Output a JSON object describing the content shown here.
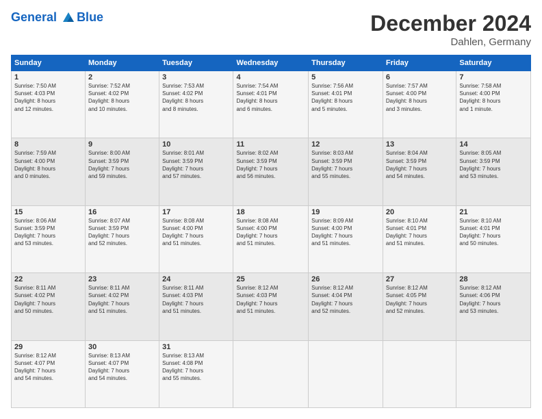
{
  "header": {
    "logo_line1": "General",
    "logo_line2": "Blue",
    "month": "December 2024",
    "location": "Dahlen, Germany"
  },
  "days_of_week": [
    "Sunday",
    "Monday",
    "Tuesday",
    "Wednesday",
    "Thursday",
    "Friday",
    "Saturday"
  ],
  "weeks": [
    [
      {
        "day": "1",
        "lines": [
          "Sunrise: 7:50 AM",
          "Sunset: 4:03 PM",
          "Daylight: 8 hours",
          "and 12 minutes."
        ]
      },
      {
        "day": "2",
        "lines": [
          "Sunrise: 7:52 AM",
          "Sunset: 4:02 PM",
          "Daylight: 8 hours",
          "and 10 minutes."
        ]
      },
      {
        "day": "3",
        "lines": [
          "Sunrise: 7:53 AM",
          "Sunset: 4:02 PM",
          "Daylight: 8 hours",
          "and 8 minutes."
        ]
      },
      {
        "day": "4",
        "lines": [
          "Sunrise: 7:54 AM",
          "Sunset: 4:01 PM",
          "Daylight: 8 hours",
          "and 6 minutes."
        ]
      },
      {
        "day": "5",
        "lines": [
          "Sunrise: 7:56 AM",
          "Sunset: 4:01 PM",
          "Daylight: 8 hours",
          "and 5 minutes."
        ]
      },
      {
        "day": "6",
        "lines": [
          "Sunrise: 7:57 AM",
          "Sunset: 4:00 PM",
          "Daylight: 8 hours",
          "and 3 minutes."
        ]
      },
      {
        "day": "7",
        "lines": [
          "Sunrise: 7:58 AM",
          "Sunset: 4:00 PM",
          "Daylight: 8 hours",
          "and 1 minute."
        ]
      }
    ],
    [
      {
        "day": "8",
        "lines": [
          "Sunrise: 7:59 AM",
          "Sunset: 4:00 PM",
          "Daylight: 8 hours",
          "and 0 minutes."
        ]
      },
      {
        "day": "9",
        "lines": [
          "Sunrise: 8:00 AM",
          "Sunset: 3:59 PM",
          "Daylight: 7 hours",
          "and 59 minutes."
        ]
      },
      {
        "day": "10",
        "lines": [
          "Sunrise: 8:01 AM",
          "Sunset: 3:59 PM",
          "Daylight: 7 hours",
          "and 57 minutes."
        ]
      },
      {
        "day": "11",
        "lines": [
          "Sunrise: 8:02 AM",
          "Sunset: 3:59 PM",
          "Daylight: 7 hours",
          "and 56 minutes."
        ]
      },
      {
        "day": "12",
        "lines": [
          "Sunrise: 8:03 AM",
          "Sunset: 3:59 PM",
          "Daylight: 7 hours",
          "and 55 minutes."
        ]
      },
      {
        "day": "13",
        "lines": [
          "Sunrise: 8:04 AM",
          "Sunset: 3:59 PM",
          "Daylight: 7 hours",
          "and 54 minutes."
        ]
      },
      {
        "day": "14",
        "lines": [
          "Sunrise: 8:05 AM",
          "Sunset: 3:59 PM",
          "Daylight: 7 hours",
          "and 53 minutes."
        ]
      }
    ],
    [
      {
        "day": "15",
        "lines": [
          "Sunrise: 8:06 AM",
          "Sunset: 3:59 PM",
          "Daylight: 7 hours",
          "and 53 minutes."
        ]
      },
      {
        "day": "16",
        "lines": [
          "Sunrise: 8:07 AM",
          "Sunset: 3:59 PM",
          "Daylight: 7 hours",
          "and 52 minutes."
        ]
      },
      {
        "day": "17",
        "lines": [
          "Sunrise: 8:08 AM",
          "Sunset: 4:00 PM",
          "Daylight: 7 hours",
          "and 51 minutes."
        ]
      },
      {
        "day": "18",
        "lines": [
          "Sunrise: 8:08 AM",
          "Sunset: 4:00 PM",
          "Daylight: 7 hours",
          "and 51 minutes."
        ]
      },
      {
        "day": "19",
        "lines": [
          "Sunrise: 8:09 AM",
          "Sunset: 4:00 PM",
          "Daylight: 7 hours",
          "and 51 minutes."
        ]
      },
      {
        "day": "20",
        "lines": [
          "Sunrise: 8:10 AM",
          "Sunset: 4:01 PM",
          "Daylight: 7 hours",
          "and 51 minutes."
        ]
      },
      {
        "day": "21",
        "lines": [
          "Sunrise: 8:10 AM",
          "Sunset: 4:01 PM",
          "Daylight: 7 hours",
          "and 50 minutes."
        ]
      }
    ],
    [
      {
        "day": "22",
        "lines": [
          "Sunrise: 8:11 AM",
          "Sunset: 4:02 PM",
          "Daylight: 7 hours",
          "and 50 minutes."
        ]
      },
      {
        "day": "23",
        "lines": [
          "Sunrise: 8:11 AM",
          "Sunset: 4:02 PM",
          "Daylight: 7 hours",
          "and 51 minutes."
        ]
      },
      {
        "day": "24",
        "lines": [
          "Sunrise: 8:11 AM",
          "Sunset: 4:03 PM",
          "Daylight: 7 hours",
          "and 51 minutes."
        ]
      },
      {
        "day": "25",
        "lines": [
          "Sunrise: 8:12 AM",
          "Sunset: 4:03 PM",
          "Daylight: 7 hours",
          "and 51 minutes."
        ]
      },
      {
        "day": "26",
        "lines": [
          "Sunrise: 8:12 AM",
          "Sunset: 4:04 PM",
          "Daylight: 7 hours",
          "and 52 minutes."
        ]
      },
      {
        "day": "27",
        "lines": [
          "Sunrise: 8:12 AM",
          "Sunset: 4:05 PM",
          "Daylight: 7 hours",
          "and 52 minutes."
        ]
      },
      {
        "day": "28",
        "lines": [
          "Sunrise: 8:12 AM",
          "Sunset: 4:06 PM",
          "Daylight: 7 hours",
          "and 53 minutes."
        ]
      }
    ],
    [
      {
        "day": "29",
        "lines": [
          "Sunrise: 8:12 AM",
          "Sunset: 4:07 PM",
          "Daylight: 7 hours",
          "and 54 minutes."
        ]
      },
      {
        "day": "30",
        "lines": [
          "Sunrise: 8:13 AM",
          "Sunset: 4:07 PM",
          "Daylight: 7 hours",
          "and 54 minutes."
        ]
      },
      {
        "day": "31",
        "lines": [
          "Sunrise: 8:13 AM",
          "Sunset: 4:08 PM",
          "Daylight: 7 hours",
          "and 55 minutes."
        ]
      },
      {
        "day": "",
        "lines": []
      },
      {
        "day": "",
        "lines": []
      },
      {
        "day": "",
        "lines": []
      },
      {
        "day": "",
        "lines": []
      }
    ]
  ]
}
